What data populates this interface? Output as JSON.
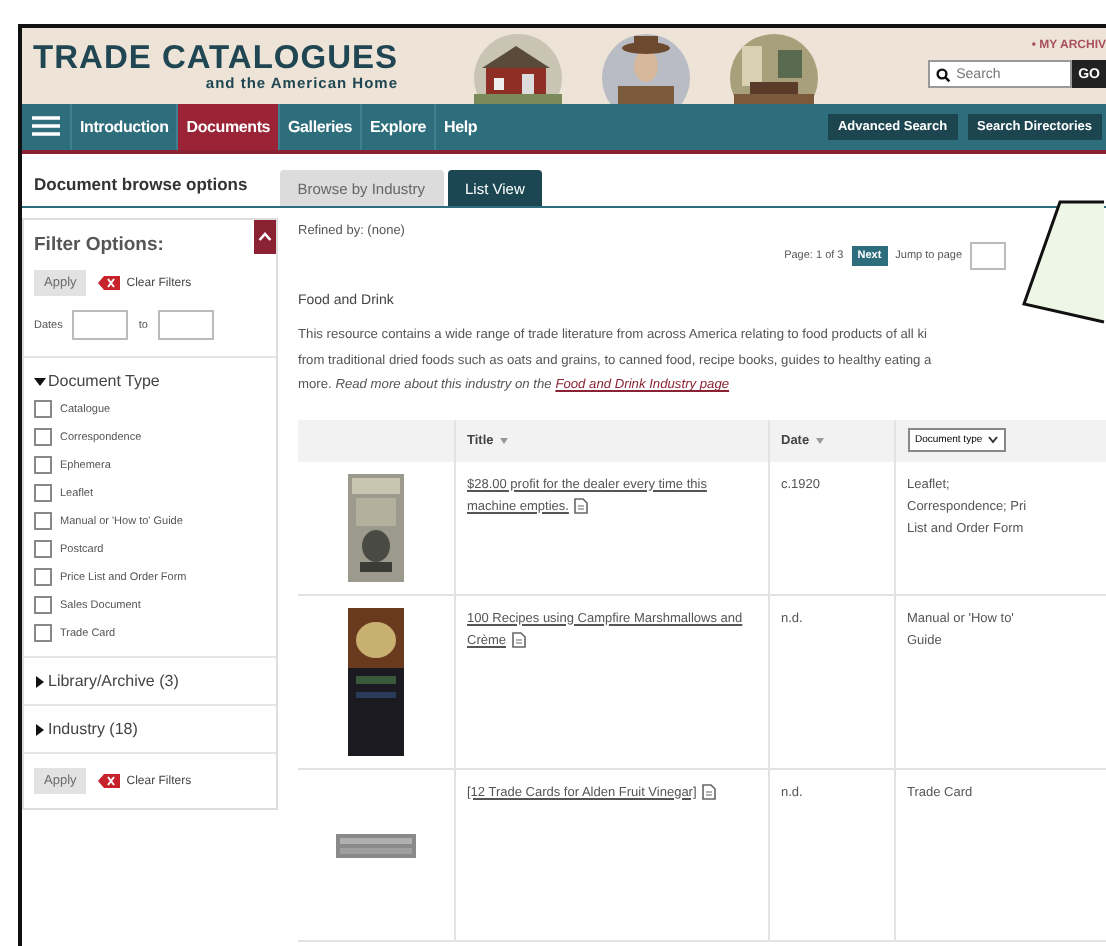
{
  "header": {
    "title": "TRADE CATALOGUES",
    "subtitle": "and the American Home",
    "account_link": "• MY ARCHIV",
    "search": {
      "placeholder": "Search"
    },
    "go_button": "GO"
  },
  "nav": {
    "items": [
      {
        "label": "Introduction",
        "selected": false
      },
      {
        "label": "Documents",
        "selected": true
      },
      {
        "label": "Galleries",
        "selected": false
      },
      {
        "label": "Explore",
        "selected": false
      },
      {
        "label": "Help",
        "selected": false
      }
    ],
    "buttons": [
      "Advanced Search",
      "Search Directories"
    ]
  },
  "browse": {
    "label": "Document browse options",
    "tabs": [
      {
        "label": "Browse by Industry",
        "selected": false
      },
      {
        "label": "List View",
        "selected": true
      }
    ]
  },
  "filters": {
    "title": "Filter Options:",
    "expanded": true,
    "apply": "Apply",
    "apply_disabled": true,
    "clear": "Clear Filters",
    "apply_bottom": "Apply",
    "clear_bottom": "Clear Filters",
    "dates_label": "Dates",
    "to_label": "to",
    "sections": [
      {
        "title": "Document Type",
        "expanded": true,
        "options": [
          {
            "label": "Catalogue",
            "checked": false
          },
          {
            "label": "Correspondence",
            "checked": false
          },
          {
            "label": "Ephemera",
            "checked": false
          },
          {
            "label": "Leaflet",
            "checked": false
          },
          {
            "label": "Manual or 'How to' Guide",
            "checked": false
          },
          {
            "label": "Postcard",
            "checked": false
          },
          {
            "label": "Price List and Order Form",
            "checked": false
          },
          {
            "label": "Sales Document",
            "checked": false
          },
          {
            "label": "Trade Card",
            "checked": false
          }
        ]
      },
      {
        "title": "Library/Archive (3)",
        "expanded": false
      },
      {
        "title": "Industry (18)",
        "expanded": false
      }
    ]
  },
  "main": {
    "refined_by": "Refined by: (none)",
    "pagination": {
      "page": "Page: 1 of 3",
      "next": "Next",
      "jump_label": "Jump to page"
    },
    "heading": "Food and Drink",
    "description_lines": [
      "This resource contains a wide range of trade literature from across America relating to food products of all ki",
      "from traditional dried foods such as oats and grains, to canned food, recipe books, guides to healthy eating a",
      "more."
    ],
    "read_more": "Read more about this industry on the",
    "read_more_link": "Food and Drink Industry page",
    "table": {
      "columns": [
        {
          "label": "Title",
          "kind": "sort"
        },
        {
          "label": "Date",
          "kind": "sort"
        },
        {
          "label": "Document type",
          "kind": "select"
        }
      ],
      "rows": [
        {
          "title": "$28.00 profit for the dealer every time this machine empties.",
          "date": "c.1920",
          "type_lines": [
            "Leaflet;",
            "Correspondence; Pri",
            "List and Order Form"
          ]
        },
        {
          "title": "100 Recipes using Campfire Marshmallows and Crème",
          "date": "n.d.",
          "type_lines": [
            "Manual or 'How to'",
            "Guide"
          ]
        },
        {
          "title": "[12 Trade Cards for Alden Fruit Vinegar]",
          "date": "n.d.",
          "type_lines": [
            "Trade Card"
          ]
        }
      ]
    }
  }
}
